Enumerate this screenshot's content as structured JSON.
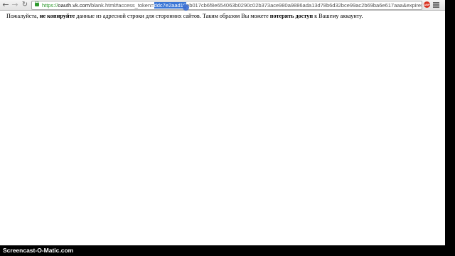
{
  "browser": {
    "url": {
      "scheme": "https://",
      "host": "oauth.vk.com",
      "path_before": "/blank.html#access_token=",
      "selected": "ddc7e2aad19",
      "path_after": "eb017cb6f8e654063b0290c02b373ace980a9886ada13d78b6d32bce99ac2b69ba6e617aaa&expires_in"
    },
    "icons": {
      "back": "back-arrow-icon",
      "forward": "forward-arrow-icon",
      "reload": "reload-icon",
      "lock": "lock-icon",
      "extension": "extension-icon",
      "menu": "menu-icon"
    },
    "extension_badge": "ABP"
  },
  "page": {
    "notice": {
      "part1": "Пожалуйста, ",
      "bold1": "не копируйте",
      "part2": " данные из адресной строки для сторонних сайтов. Таким образом Вы можете ",
      "bold2": "потерять доступ",
      "part3": " к Вашему аккаунту."
    }
  },
  "watermark": "Screencast-O-Matic.com",
  "colors": {
    "selection": "#3a76d6",
    "secure_green": "#2f9a2f",
    "frame_bg": "#000000"
  }
}
